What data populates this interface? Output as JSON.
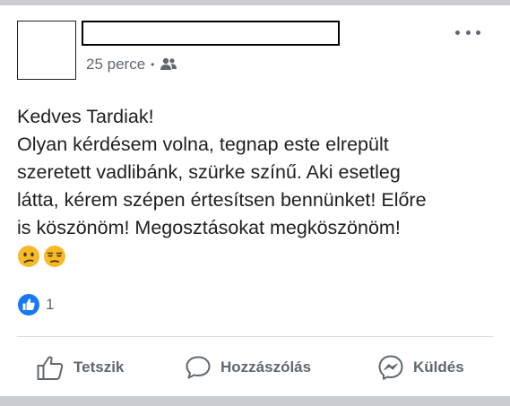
{
  "post": {
    "time": "25 perce",
    "separator": "•",
    "audience_icon": "friends-icon",
    "lines": [
      "Kedves Tardiak!",
      "Olyan kérdésem volna, tegnap este elrepült",
      "szeretett vadlibánk, szürke színű. Aki esetleg",
      "látta, kérem szépen értesítsen bennünket! Előre",
      "is köszönöm! Megosztásokat megköszönöm!"
    ],
    "emojis": [
      "confused-face-icon",
      "unamused-face-icon"
    ]
  },
  "reactions": {
    "count": "1",
    "icon": "like-reaction-icon"
  },
  "actions": {
    "like_label": "Tetszik",
    "comment_label": "Hozzászólás",
    "send_label": "Küldés"
  },
  "colors": {
    "accent": "#1877f2",
    "secondary_text": "#606770",
    "text": "#1c1e21",
    "divider": "#dadde1",
    "edge": "#c9ccd1"
  }
}
